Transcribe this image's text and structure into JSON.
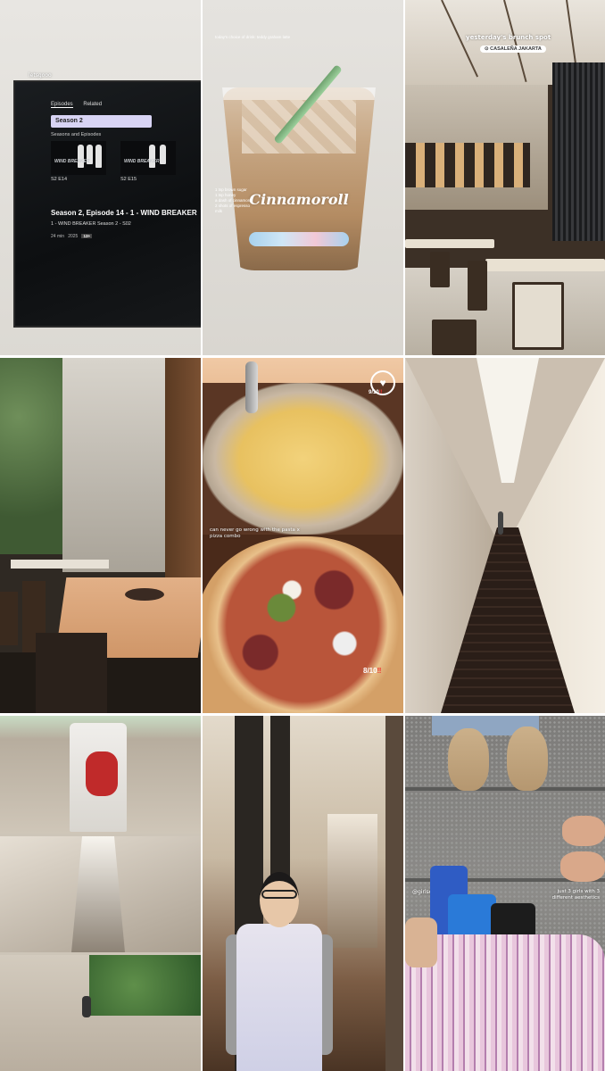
{
  "tiles": {
    "t1": {
      "caption": "letsgooo",
      "tv": {
        "tabs": [
          "Episodes",
          "Related"
        ],
        "season": "Season 2",
        "section": "Seasons and Episodes",
        "episodes": [
          {
            "logo": "WIND BREAKER",
            "label": "S2 E14"
          },
          {
            "logo": "WIND BREAKER",
            "label": "S2 E15"
          }
        ],
        "title": "Season 2, Episode 14 - 1 - WIND BREAKER",
        "subtitle": "1 - WIND BREAKER Season 2 - S02",
        "meta": {
          "duration": "24 min",
          "year": "2025",
          "rating": "13+"
        }
      }
    },
    "t2": {
      "heading": "today's choice of drink: teddy graham latte",
      "recipe": [
        "1 tsp brown sugar",
        "1 tsp honey",
        "a dash of cinnamon",
        "2 shots of espresso",
        "milk"
      ],
      "cup_logo": "Cinnamoroll"
    },
    "t3": {
      "caption": "yesterday's brunch spot",
      "location": "CASALEÑA JAKARTA",
      "location_icon": "pin-icon"
    },
    "t5": {
      "top_score": "9/10",
      "caption": "can never go wrong with the pasta x pizza combo",
      "bottom_score": "8/10",
      "score_mark": "‼",
      "heart_icon": "heart-icon"
    },
    "t9": {
      "handle": "@girlscarryingshit",
      "caption": "just 3 girls with 3 different aesthetics"
    }
  }
}
